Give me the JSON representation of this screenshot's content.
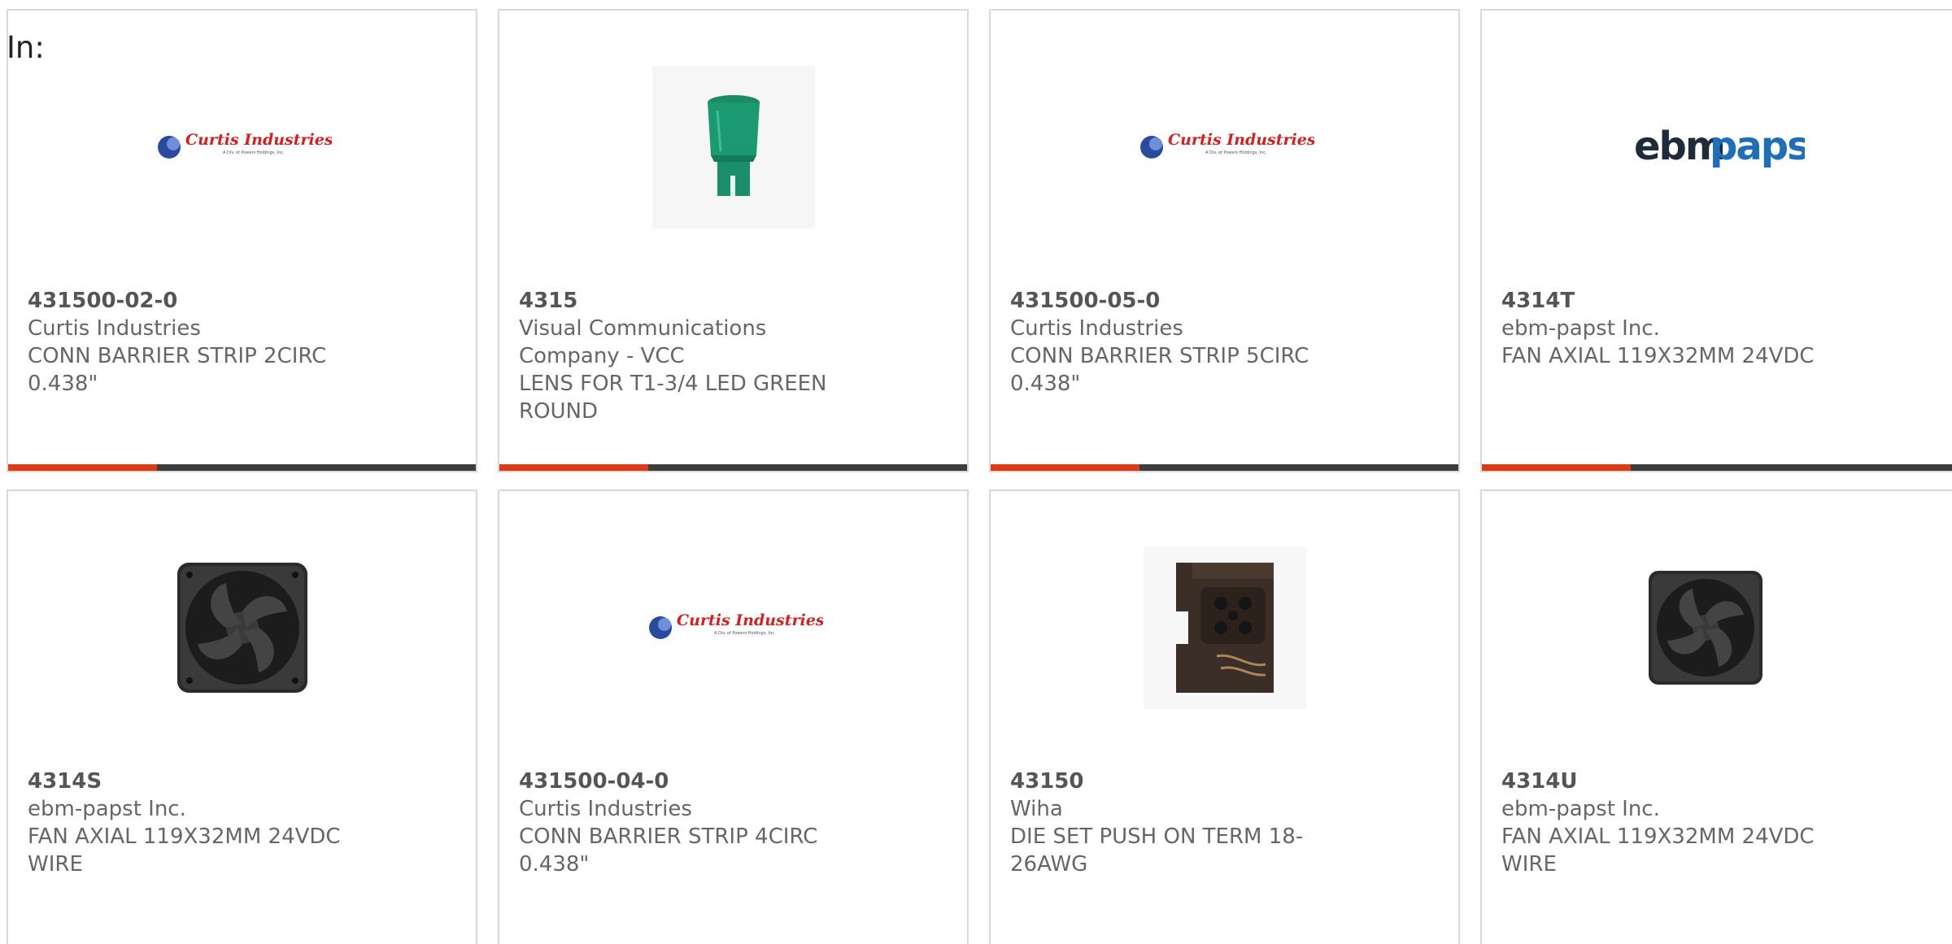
{
  "filter_label": "In:",
  "colors": {
    "accent": "#e03a12",
    "bar": "#3d3d3d",
    "border": "#d9d9d9"
  },
  "products": [
    {
      "part_no": "431500-02-0",
      "maker": "Curtis Industries",
      "desc": "CONN BARRIER STRIP 2CIRC 0.438\"",
      "image": "curtis-industries-logo",
      "logo_text": "Curtis Industries",
      "logo_sub": "A Div. of Powers Holdings, Inc."
    },
    {
      "part_no": "4315",
      "maker": "Visual Communications Company - VCC",
      "desc": "LENS FOR T1-3/4 LED GREEN ROUND",
      "image": "green-led-lens-photo"
    },
    {
      "part_no": "431500-05-0",
      "maker": "Curtis Industries",
      "desc": "CONN BARRIER STRIP 5CIRC 0.438\"",
      "image": "curtis-industries-logo",
      "logo_text": "Curtis Industries",
      "logo_sub": "A Div. of Powers Holdings, Inc."
    },
    {
      "part_no": "4314T",
      "maker": "ebm-papst Inc.",
      "desc": "FAN AXIAL 119X32MM 24VDC",
      "image": "ebmpapst-logo",
      "logo_text_a": "ebm",
      "logo_text_b": "papst"
    },
    {
      "part_no": "4314S",
      "maker": "ebm-papst Inc.",
      "desc": "FAN AXIAL 119X32MM 24VDC WIRE",
      "image": "axial-fan-photo"
    },
    {
      "part_no": "431500-04-0",
      "maker": "Curtis Industries",
      "desc": "CONN BARRIER STRIP 4CIRC 0.438\"",
      "image": "curtis-industries-logo",
      "logo_text": "Curtis Industries",
      "logo_sub": "A Div. of Powers Holdings, Inc."
    },
    {
      "part_no": "43150",
      "maker": "Wiha",
      "desc": "DIE SET PUSH ON TERM 18-26AWG",
      "image": "crimp-die-set-photo"
    },
    {
      "part_no": "4314U",
      "maker": "ebm-papst Inc.",
      "desc": "FAN AXIAL 119X32MM 24VDC WIRE",
      "image": "axial-fan-photo"
    }
  ]
}
